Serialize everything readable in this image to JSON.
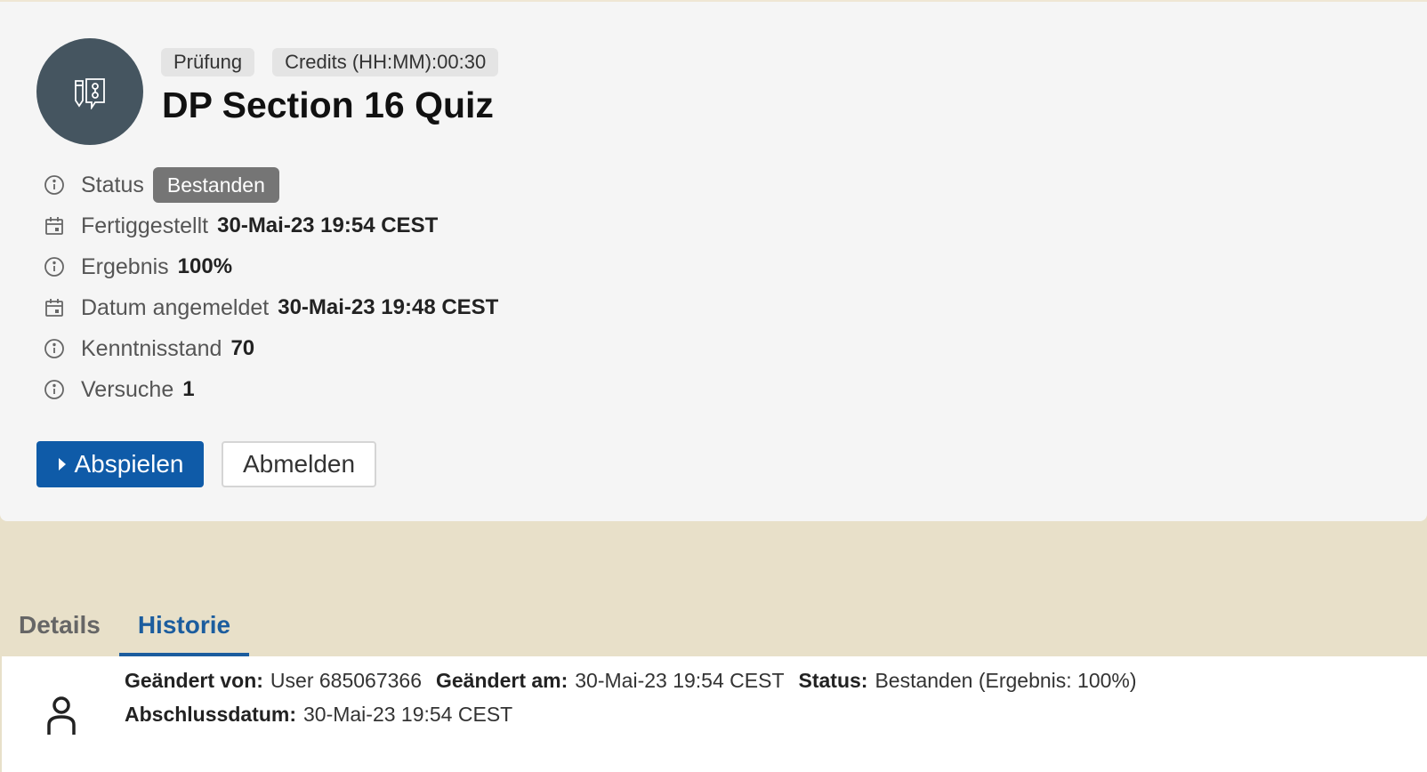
{
  "header": {
    "chips": [
      "Prüfung",
      "Credits (HH:MM):00:30"
    ],
    "title": "DP Section 16 Quiz",
    "icon": "quiz-icon"
  },
  "info": {
    "status_label": "Status",
    "status_value": "Bestanden",
    "completed_label": "Fertiggestellt",
    "completed_value": "30-Mai-23 19:54 CEST",
    "result_label": "Ergebnis",
    "result_value": "100%",
    "registered_label": "Datum angemeldet",
    "registered_value": "30-Mai-23 19:48 CEST",
    "knowledge_label": "Kenntnisstand",
    "knowledge_value": "70",
    "attempts_label": "Versuche",
    "attempts_value": "1"
  },
  "actions": {
    "play_label": "Abspielen",
    "unregister_label": "Abmelden"
  },
  "tabs": [
    {
      "label": "Details",
      "active": false
    },
    {
      "label": "Historie",
      "active": true
    }
  ],
  "history": {
    "changed_by_label": "Geändert von:",
    "changed_by_value": "User 685067366",
    "changed_at_label": "Geändert am:",
    "changed_at_value": "30-Mai-23 19:54 CEST",
    "status_label": "Status:",
    "status_value": "Bestanden (Ergebnis: 100%)",
    "completion_label": "Abschlussdatum:",
    "completion_value": "30-Mai-23 19:54 CEST"
  },
  "colors": {
    "primary": "#0f5ba8",
    "tab_active": "#1c5d9e",
    "badge": "#757575",
    "avatar": "#455560",
    "page_bg": "#e8e0c9"
  }
}
